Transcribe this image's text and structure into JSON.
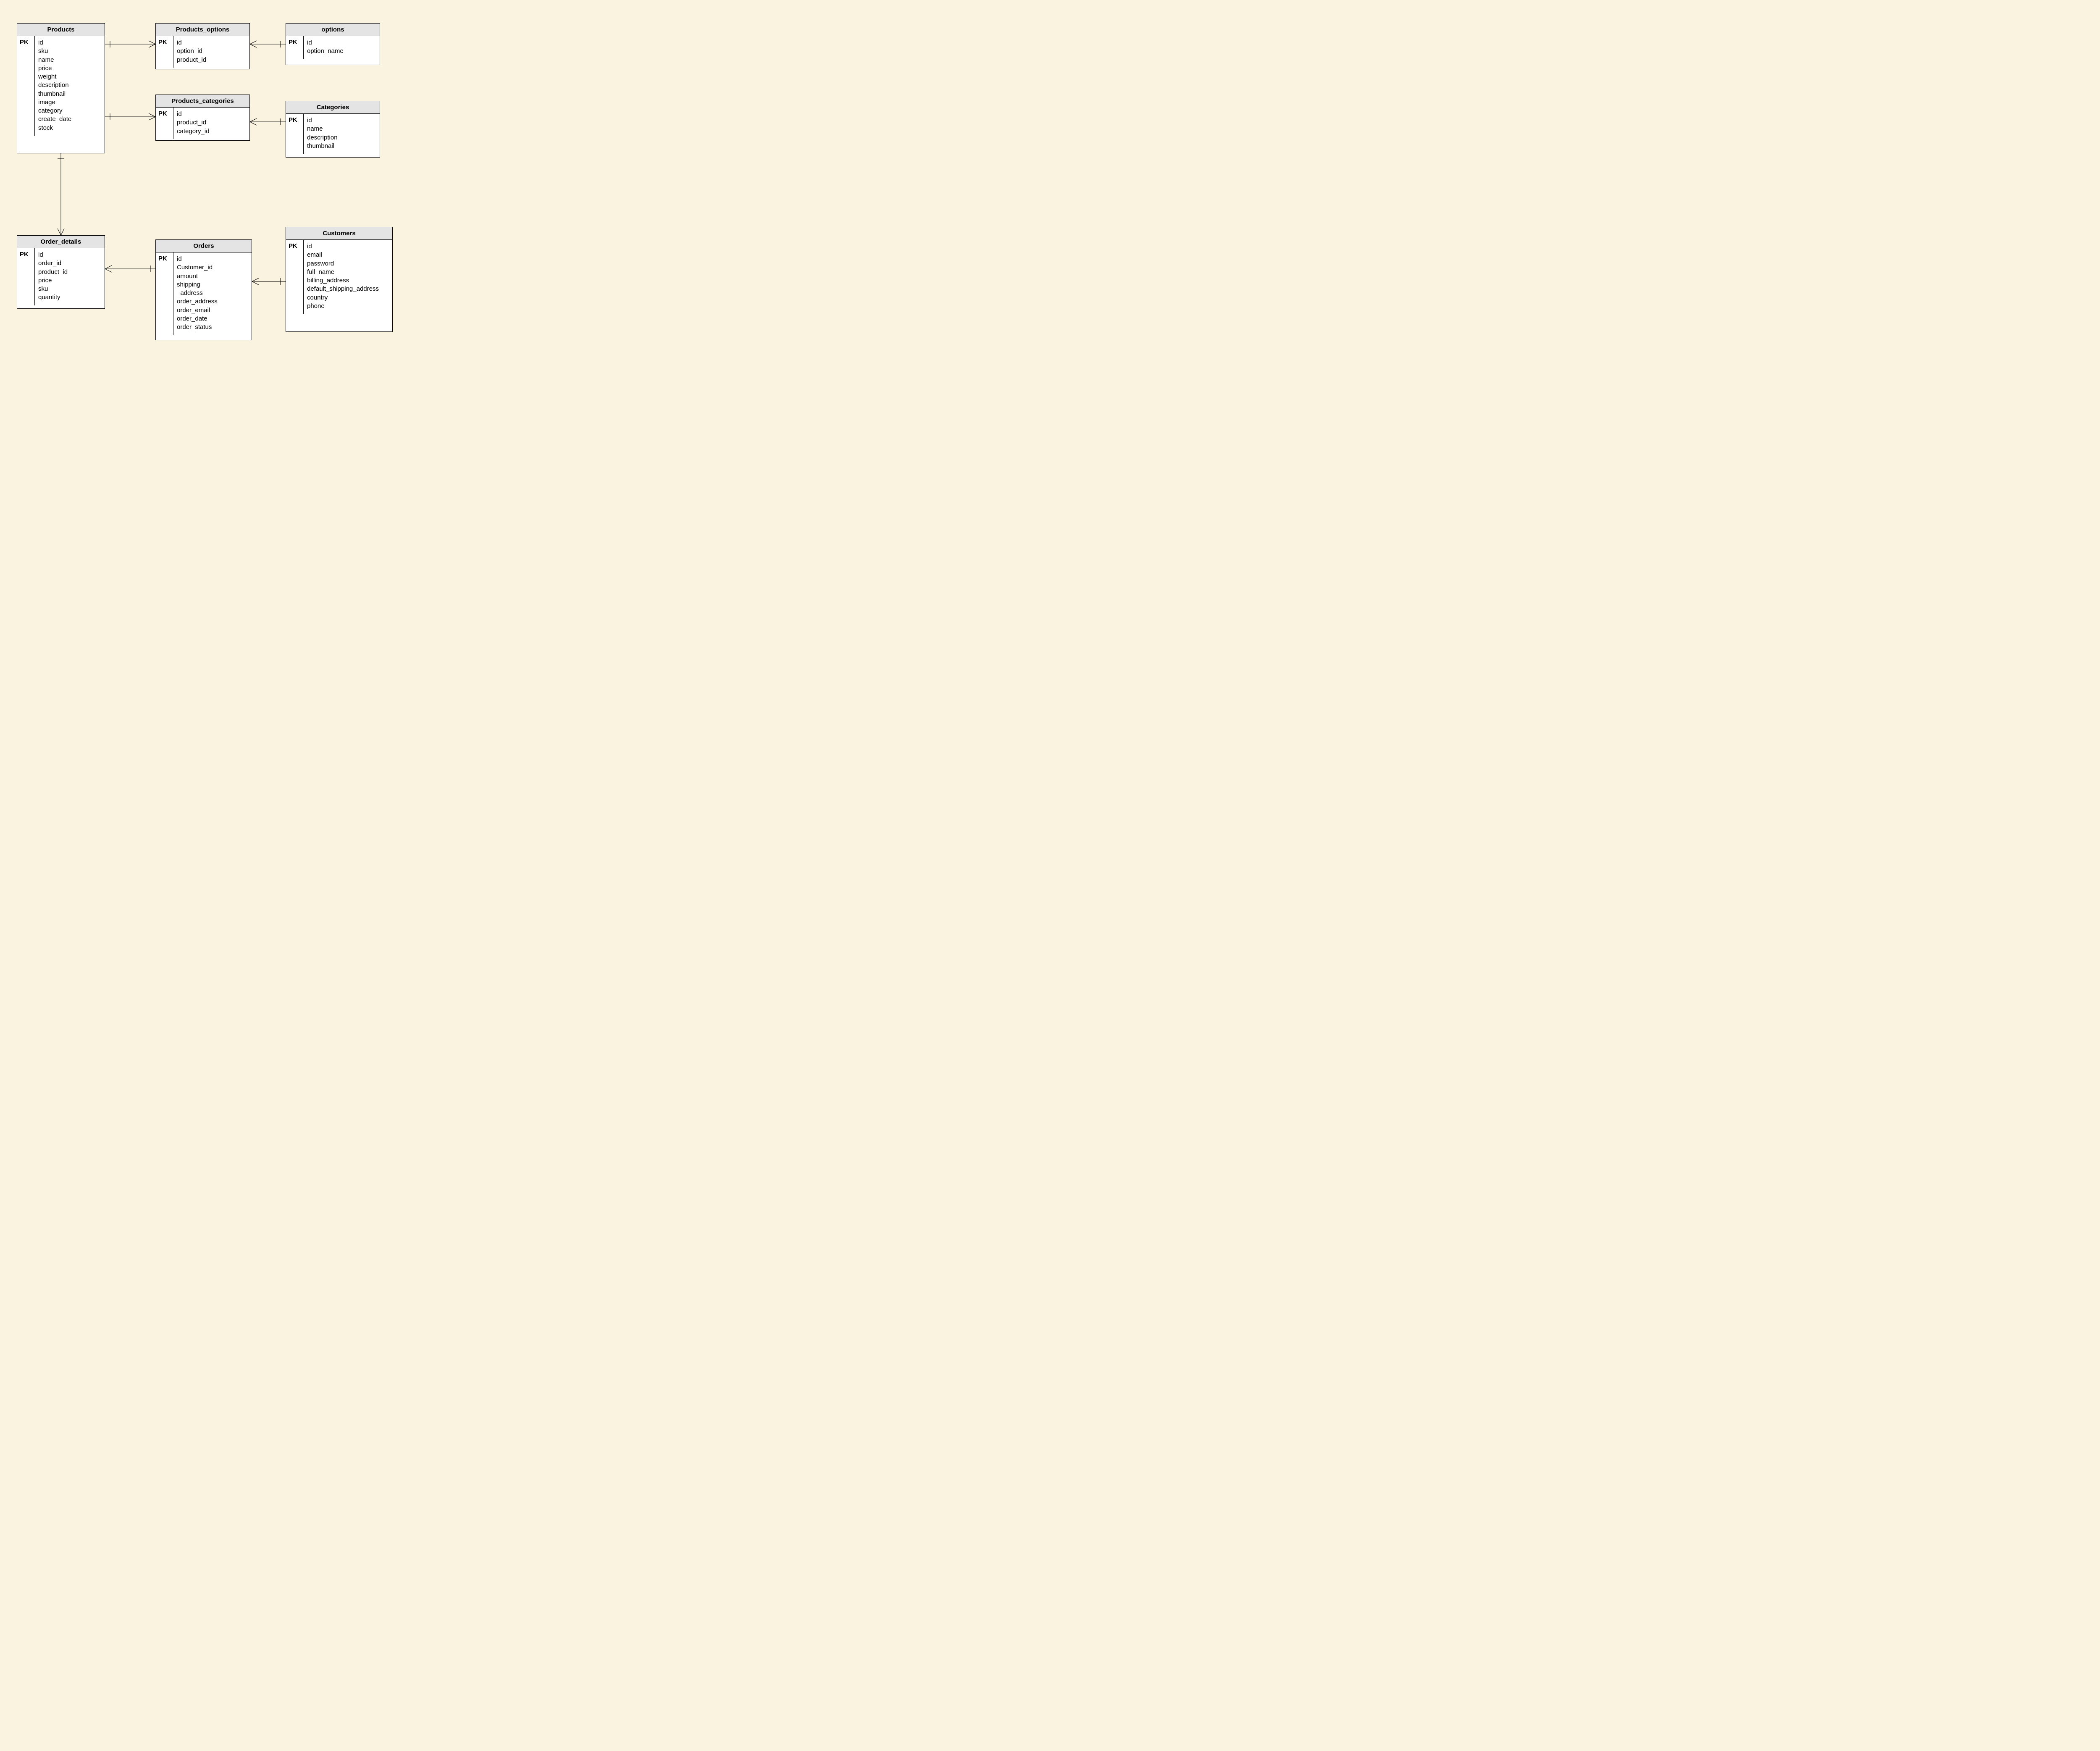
{
  "entities": {
    "products": {
      "title": "Products",
      "pk": "PK",
      "fields": [
        "id",
        "sku",
        "name",
        "price",
        "weight",
        "description",
        "thumbnail",
        "image",
        "category",
        "create_date",
        "stock"
      ]
    },
    "products_options": {
      "title": "Products_options",
      "pk": "PK",
      "fields": [
        "id",
        "option_id",
        "product_id"
      ]
    },
    "options": {
      "title": "options",
      "pk": "PK",
      "fields": [
        "id",
        "option_name"
      ]
    },
    "products_categories": {
      "title": "Products_categories",
      "pk": "PK",
      "fields": [
        "id",
        "product_id",
        "category_id"
      ]
    },
    "categories": {
      "title": "Categories",
      "pk": "PK",
      "fields": [
        "id",
        "name",
        "description",
        "thumbnail"
      ]
    },
    "order_details": {
      "title": "Order_details",
      "pk": "PK",
      "fields": [
        "id",
        "order_id",
        "product_id",
        "price",
        "sku",
        "quantity"
      ]
    },
    "orders": {
      "title": "Orders",
      "pk": "PK",
      "fields": [
        "id",
        "Customer_id",
        "amount",
        "shipping",
        "_address",
        "order_address",
        "order_email",
        "order_date",
        "order_status"
      ]
    },
    "customers": {
      "title": "Customers",
      "pk": "PK",
      "fields": [
        "id",
        "email",
        "password",
        "full_name",
        "billing_address",
        "default_shipping_address",
        "country",
        "phone"
      ]
    }
  },
  "relations": [
    {
      "from": "products",
      "to": "products_options",
      "fromCard": "one",
      "toCard": "many"
    },
    {
      "from": "products_options",
      "to": "options",
      "fromCard": "many",
      "toCard": "one"
    },
    {
      "from": "products",
      "to": "products_categories",
      "fromCard": "one",
      "toCard": "many"
    },
    {
      "from": "products_categories",
      "to": "categories",
      "fromCard": "many",
      "toCard": "one"
    },
    {
      "from": "products",
      "to": "order_details",
      "fromCard": "one",
      "toCard": "many"
    },
    {
      "from": "order_details",
      "to": "orders",
      "fromCard": "many",
      "toCard": "one"
    },
    {
      "from": "orders",
      "to": "customers",
      "fromCard": "many",
      "toCard": "one"
    }
  ]
}
